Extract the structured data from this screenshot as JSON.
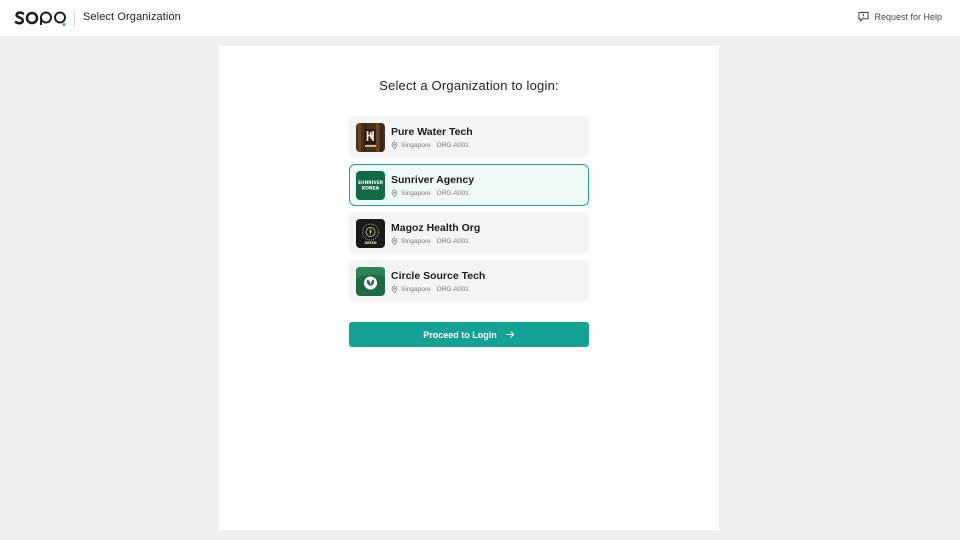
{
  "header": {
    "logo_text": "sopo",
    "title": "Select Organization",
    "help_label": "Request for Help",
    "help_icon": "message-square-icon"
  },
  "main": {
    "heading": "Select a Organization to login:",
    "organizations": [
      {
        "name": "Pure Water Tech",
        "location": "Singapore",
        "code": "ORG-A001",
        "logo": "pure-water-logo",
        "selected": false
      },
      {
        "name": "Sunriver Agency",
        "location": "Singapore",
        "code": "ORG-A001",
        "logo": "sunriver-logo",
        "logo_text": "SUNRIVER KOREA",
        "selected": true
      },
      {
        "name": "Magoz Health Org",
        "location": "Singapore",
        "code": "ORG-A001",
        "logo": "magoz-logo",
        "logo_text": "GREEN",
        "selected": false
      },
      {
        "name": "Circle Source Tech",
        "location": "Singapore",
        "code": "ORG-A001",
        "logo": "circle-source-logo",
        "selected": false
      }
    ],
    "proceed_label": "Proceed to Login"
  },
  "colors": {
    "accent": "#16a196",
    "selected_border": "#1aa79c",
    "selected_bg": "#effaf7",
    "page_bg": "#efefef",
    "item_bg": "#f4f4f4"
  }
}
